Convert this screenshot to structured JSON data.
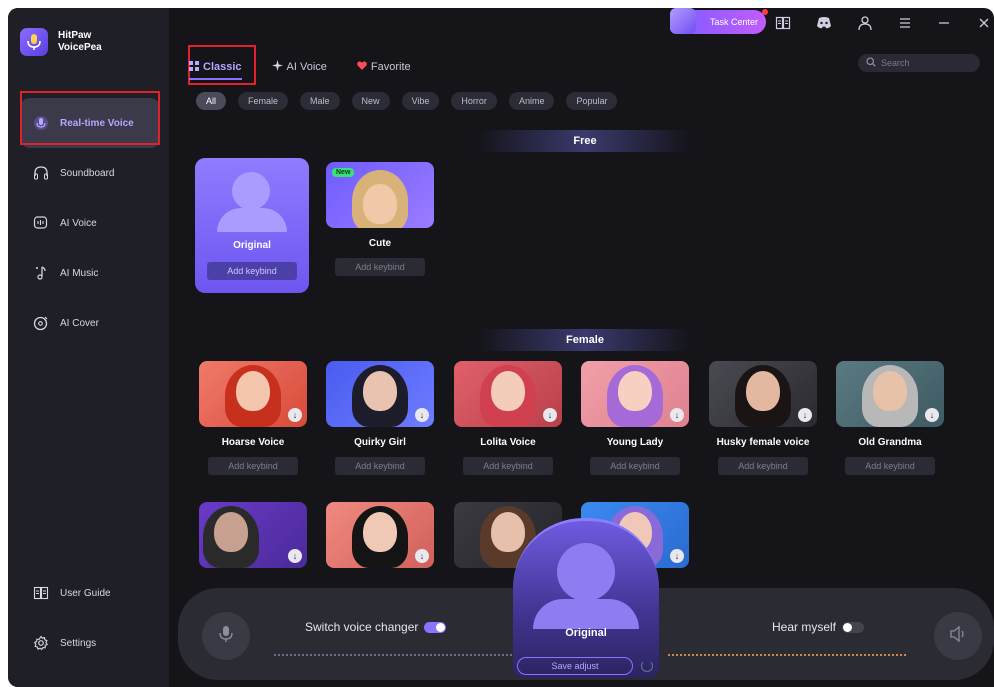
{
  "app": {
    "name_line1": "HitPaw",
    "name_line2": "VoicePea"
  },
  "sidebar": {
    "items": [
      {
        "label": "Real-time Voice",
        "icon": "microphone-icon"
      },
      {
        "label": "Soundboard",
        "icon": "headphones-icon"
      },
      {
        "label": "AI Voice",
        "icon": "ai-voice-icon"
      },
      {
        "label": "AI Music",
        "icon": "music-note-icon"
      },
      {
        "label": "AI Cover",
        "icon": "disc-icon"
      }
    ],
    "bottom": [
      {
        "label": "User Guide",
        "icon": "book-icon"
      },
      {
        "label": "Settings",
        "icon": "gear-icon"
      }
    ]
  },
  "topbar": {
    "task_center": "Task Center"
  },
  "tabs": [
    {
      "label": "Classic",
      "icon": "grid-icon"
    },
    {
      "label": "AI Voice",
      "icon": "sparkle-icon"
    },
    {
      "label": "Favorite",
      "icon": "heart-icon"
    }
  ],
  "search": {
    "placeholder": "Search"
  },
  "filters": [
    "All",
    "Female",
    "Male",
    "New",
    "Vibe",
    "Horror",
    "Anime",
    "Popular"
  ],
  "sections": {
    "free": "Free",
    "female": "Female"
  },
  "free_voices": [
    {
      "name": "Original",
      "keybind": "Add keybind"
    },
    {
      "name": "Cute",
      "keybind": "Add keybind",
      "badge": "New"
    }
  ],
  "female_voices": [
    {
      "name": "Hoarse Voice",
      "keybind": "Add keybind"
    },
    {
      "name": "Quirky Girl",
      "keybind": "Add keybind"
    },
    {
      "name": "Lolita Voice",
      "keybind": "Add keybind"
    },
    {
      "name": "Young Lady",
      "keybind": "Add keybind"
    },
    {
      "name": "Husky female voice",
      "keybind": "Add keybind"
    },
    {
      "name": "Old Grandma",
      "keybind": "Add keybind"
    }
  ],
  "bottom_bar": {
    "switch_voice_changer": "Switch voice changer",
    "hear_myself": "Hear myself",
    "current_voice": "Original",
    "save_adjust": "Save adjust",
    "voice_changer_on": true,
    "hear_myself_on": false
  },
  "colors": {
    "accent": "#8d72ff",
    "background": "#141419",
    "sidebar": "#1f1f27",
    "highlight_box": "#e0232b"
  }
}
